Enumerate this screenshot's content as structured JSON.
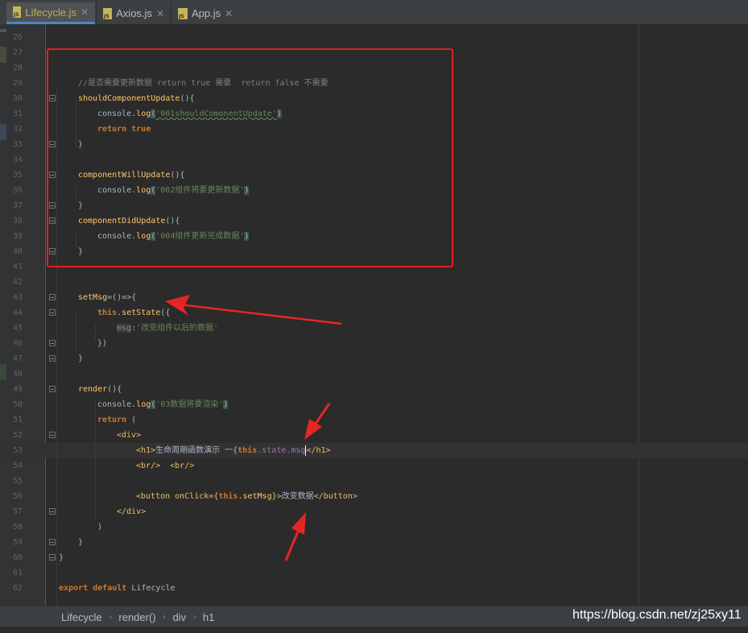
{
  "tabs": [
    {
      "label": "Lifecycle.js",
      "active": true
    },
    {
      "label": "Axios.js",
      "active": false
    },
    {
      "label": "App.js",
      "active": false
    }
  ],
  "code_lines": [
    {
      "n": "26"
    },
    {
      "n": "27"
    },
    {
      "n": "28"
    },
    {
      "n": "29",
      "comment": "//是否需要更新数据 return true 需要  return false 不需要"
    },
    {
      "n": "30",
      "fn": "shouldComponentUpdate",
      "rest": "(){"
    },
    {
      "n": "31",
      "obj": "console.",
      "fn": "log",
      "open": "(",
      "str": "'001shouldComonentUpdate'",
      "close": ")"
    },
    {
      "n": "32",
      "kw": "return true"
    },
    {
      "n": "33",
      "plain": "}"
    },
    {
      "n": "34"
    },
    {
      "n": "35",
      "fn": "componentWillUpdate",
      "rest": "(){"
    },
    {
      "n": "36",
      "obj": "console.",
      "fn": "log",
      "open": "(",
      "str": "'002组件将要更新数据'",
      "close": ")"
    },
    {
      "n": "37",
      "plain": "}"
    },
    {
      "n": "38",
      "fn": "componentDidUpdate",
      "rest": "(){"
    },
    {
      "n": "39",
      "obj": "console.",
      "fn": "log",
      "open": "(",
      "str": "'004组件更新完成数据'",
      "close": ")"
    },
    {
      "n": "40",
      "plain": "}"
    },
    {
      "n": "41"
    },
    {
      "n": "42"
    },
    {
      "n": "43",
      "fn": "setMsg",
      "rest": "=()=>{"
    },
    {
      "n": "44",
      "kw": "this",
      "dot": ".",
      "fn": "setState",
      "rest": "({"
    },
    {
      "n": "45",
      "prop": "msg",
      "colon": ":",
      "str": "'改变组件以后的数据'"
    },
    {
      "n": "46",
      "plain": "})"
    },
    {
      "n": "47",
      "plain": "}"
    },
    {
      "n": "48"
    },
    {
      "n": "49",
      "fn": "render",
      "rest": "(){"
    },
    {
      "n": "50",
      "obj": "console.",
      "fn": "log",
      "open": "(",
      "str": "'03数据将要渲染'",
      "close": ")"
    },
    {
      "n": "51",
      "kw": "return",
      "rest": " ("
    },
    {
      "n": "52",
      "tag": "<div>"
    },
    {
      "n": "53",
      "tag": "<h1>",
      "text": "生命周期函数演示 一{",
      "kw": "this",
      "prop": ".state.msg",
      "cursor": true,
      "tag2": "</h1>"
    },
    {
      "n": "54",
      "tag": "<br/>  <br/>"
    },
    {
      "n": "55"
    },
    {
      "n": "56",
      "tag": "<button onClick={",
      "kw": "this",
      "fn": ".setMsg",
      "tag2": "}>",
      "text": "改变数据",
      "tag3": "</button>"
    },
    {
      "n": "57",
      "tag": "</div>"
    },
    {
      "n": "58",
      "plain": ")"
    },
    {
      "n": "59",
      "plain": "}"
    },
    {
      "n": "60",
      "plain": "}"
    },
    {
      "n": "61"
    },
    {
      "n": "62",
      "kw": "export default",
      "rest": " Lifecycle"
    }
  ],
  "breadcrumb": [
    "Lifecycle",
    "render()",
    "div",
    "h1"
  ],
  "watermark": "https://blog.csdn.net/zj25xy11",
  "colors": {
    "annotation": "#e02020",
    "keyword": "#cc7832",
    "function": "#ffc66d",
    "string": "#6a8759",
    "comment": "#808080"
  }
}
